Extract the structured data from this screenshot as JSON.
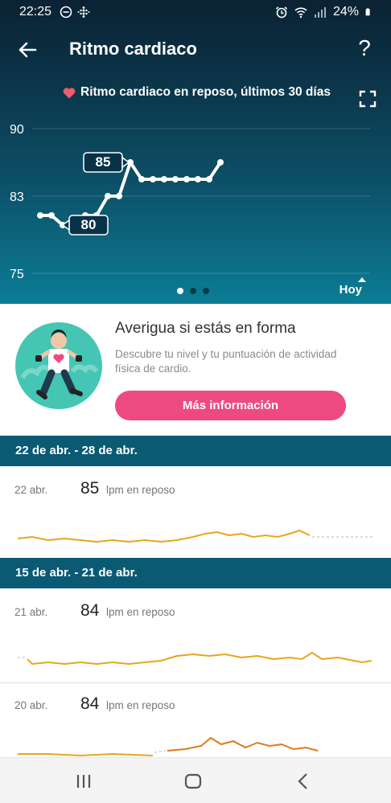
{
  "status": {
    "time": "22:25",
    "battery": "24%"
  },
  "appbar": {
    "title": "Ritmo cardiaco",
    "help_label": "?"
  },
  "chart_caption": "Ritmo cardiaco en reposo, últimos 30 días",
  "chart_data": {
    "type": "line",
    "ylim": [
      75,
      90
    ],
    "yticks": [
      90,
      83,
      75
    ],
    "x": [
      1,
      2,
      3,
      4,
      5,
      6,
      7,
      8,
      9,
      10,
      11,
      12,
      13,
      14,
      15,
      16,
      17
    ],
    "values": [
      81,
      81,
      80,
      80,
      81,
      81,
      83,
      83,
      85,
      84,
      84,
      84,
      84,
      84,
      84,
      84,
      85
    ],
    "max_label": "85",
    "min_label": "80",
    "x_end_label": "Hoy",
    "accent_color": "#ffffff"
  },
  "promo": {
    "title": "Averigua si estás en forma",
    "description": "Descubre tu nivel y tu puntuación de actividad física de cardio.",
    "button_label": "Más información",
    "button_color": "#ee4a82"
  },
  "weeks": [
    {
      "label": "22 de abr. - 28 de abr."
    },
    {
      "label": "15 de abr. - 21 de abr."
    }
  ],
  "days": [
    {
      "date": "22 abr.",
      "value": "85",
      "unit": "lpm en reposo"
    },
    {
      "date": "21 abr.",
      "value": "84",
      "unit": "lpm en reposo"
    },
    {
      "date": "20 abr.",
      "value": "84",
      "unit": "lpm en reposo"
    }
  ]
}
